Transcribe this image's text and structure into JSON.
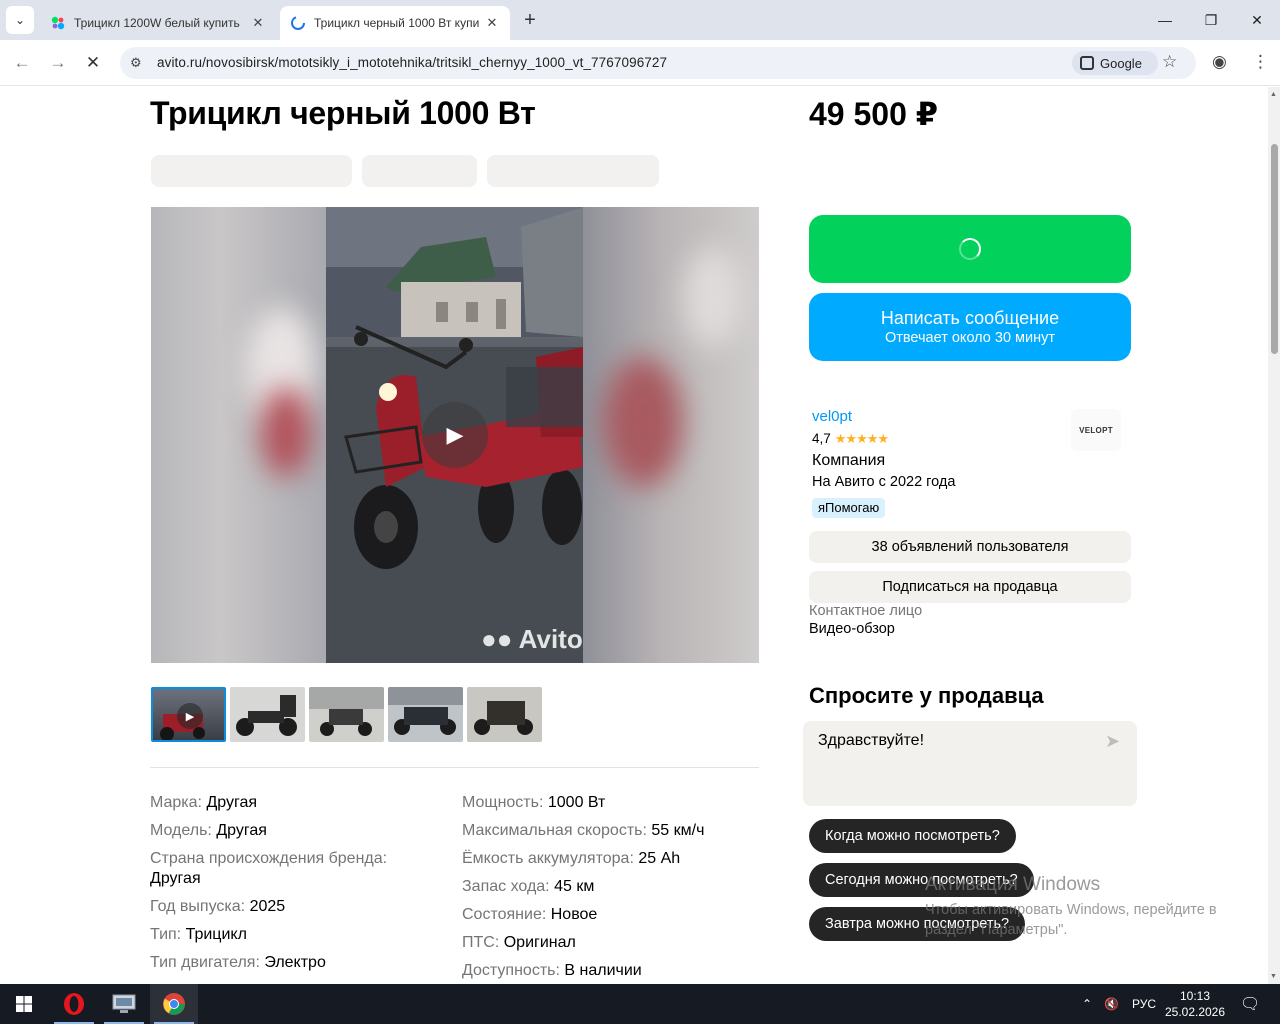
{
  "browser": {
    "tabs": [
      {
        "title": "Трицикл 1200W белый купить",
        "active": false
      },
      {
        "title": "Трицикл черный 1000 Вт купи",
        "active": true
      }
    ],
    "url": "avito.ru/novosibirsk/mototsikly_i_mototehnika/tritsikl_chernyy_1000_vt_7767096727",
    "google_chip": "Google"
  },
  "listing": {
    "title": "Трицикл черный 1000 Вт",
    "price": "49 500 ₽",
    "watermark": "Avito",
    "params_left": [
      {
        "key": "Марка:",
        "value": "Другая"
      },
      {
        "key": "Модель:",
        "value": "Другая"
      },
      {
        "key": "Страна происхождения бренда:",
        "value": "Другая"
      },
      {
        "key": "Год выпуска:",
        "value": "2025"
      },
      {
        "key": "Тип:",
        "value": "Трицикл"
      },
      {
        "key": "Тип двигателя:",
        "value": "Электро"
      }
    ],
    "params_right": [
      {
        "key": "Мощность:",
        "value": "1000 Вт"
      },
      {
        "key": "Максимальная скорость:",
        "value": "55 км/ч"
      },
      {
        "key": "Ёмкость аккумулятора:",
        "value": "25 Ah"
      },
      {
        "key": "Запас хода:",
        "value": "45 км"
      },
      {
        "key": "Состояние:",
        "value": "Новое"
      },
      {
        "key": "ПТС:",
        "value": "Оригинал"
      },
      {
        "key": "Доступность:",
        "value": "В наличии"
      }
    ]
  },
  "actions": {
    "message_title": "Написать сообщение",
    "message_sub": "Отвечает около 30 минут"
  },
  "seller": {
    "name": "vel0pt",
    "rating": "4,7",
    "type": "Компания",
    "since": "На Авито с 2022 года",
    "badge": "яПомогаю",
    "logo_text": "VELOPT",
    "listings_button": "38 объявлений пользователя",
    "subscribe_button": "Подписаться на продавца",
    "contact_label": "Контактное лицо",
    "contact_value": "Видео-обзор"
  },
  "ask": {
    "title": "Спросите у продавца",
    "message": "Здравствуйте!",
    "chips": [
      "Когда можно посмотреть?",
      "Сегодня можно посмотреть?",
      "Завтра можно посмотреть?"
    ]
  },
  "windows": {
    "activation_title": "Активация Windows",
    "activation_text": "Чтобы активировать Windows, перейдите в раздел \"Параметры\".",
    "lang": "РУС",
    "time": "10:13",
    "date": "25.02.2026"
  },
  "colors": {
    "call_green": "#02d15c",
    "message_blue": "#00aaff",
    "seller_link": "#0099f7"
  }
}
